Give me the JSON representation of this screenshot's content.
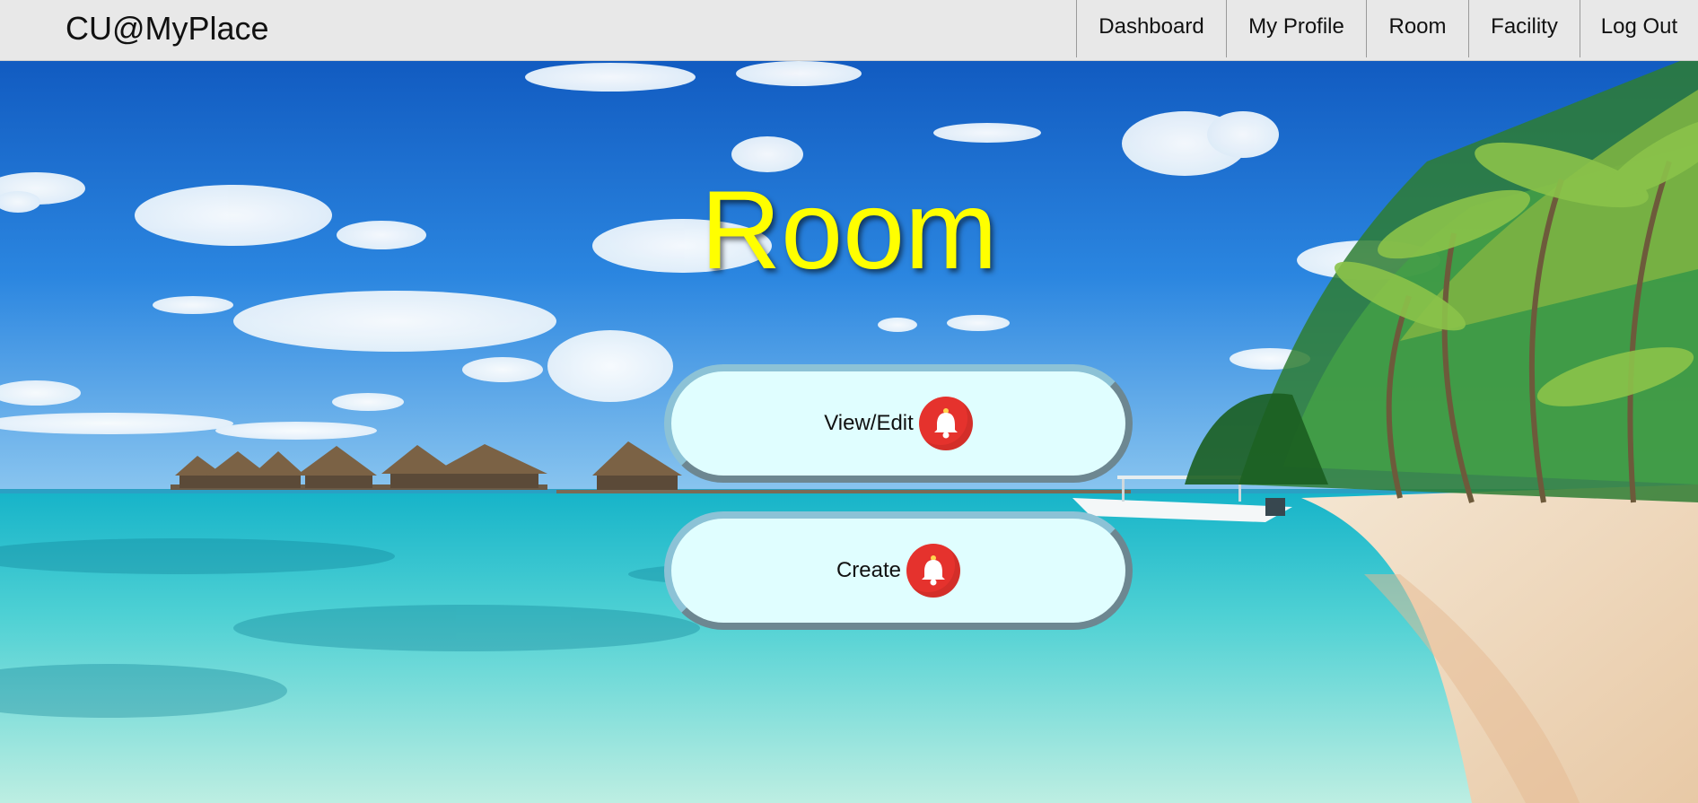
{
  "nav": {
    "brand": "CU@MyPlace",
    "links": [
      {
        "label": "Dashboard"
      },
      {
        "label": "My Profile"
      },
      {
        "label": "Room"
      },
      {
        "label": "Facility"
      },
      {
        "label": "Log Out"
      }
    ]
  },
  "page": {
    "title": "Room"
  },
  "actions": [
    {
      "label": "View/Edit",
      "icon": "bell-icon"
    },
    {
      "label": "Create",
      "icon": "bell-icon"
    }
  ],
  "colors": {
    "title": "#ffff00",
    "pill_bg": "#e0feff",
    "bell": "#e5322d",
    "navbar": "#e8e8e8"
  }
}
